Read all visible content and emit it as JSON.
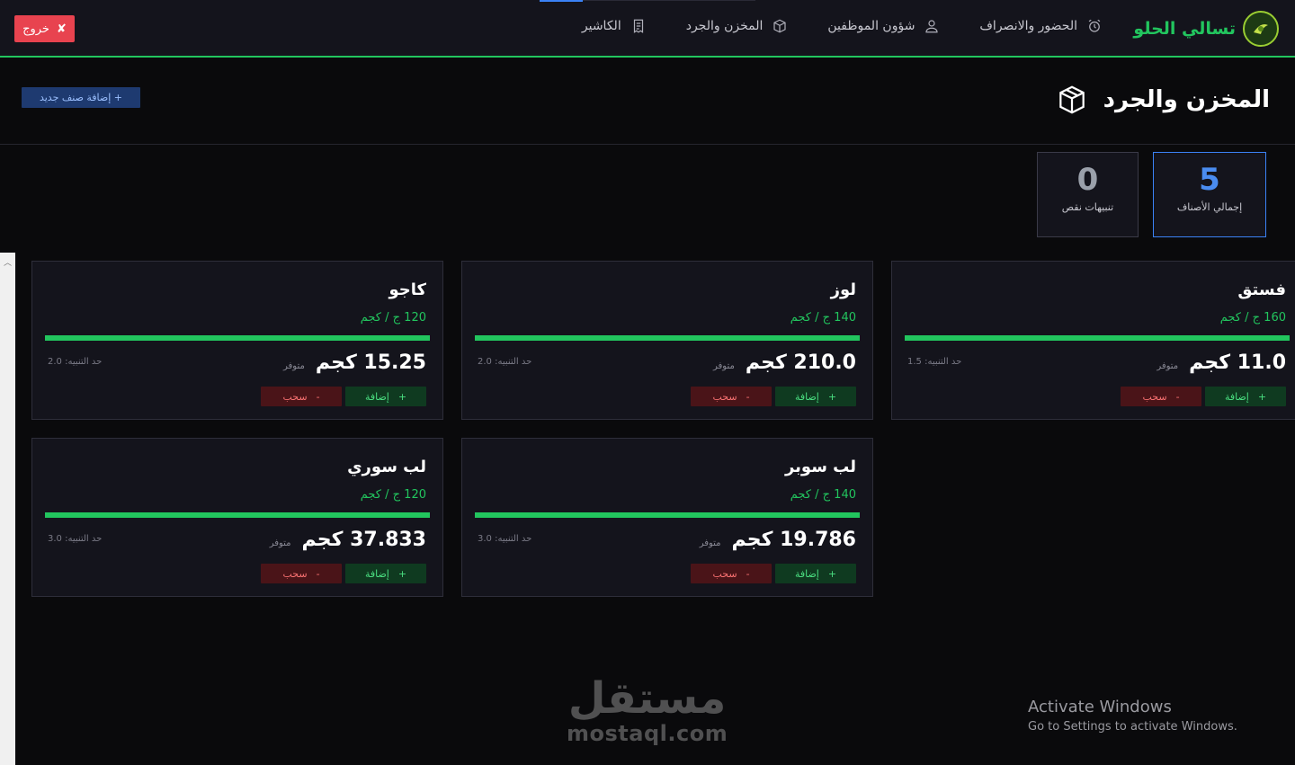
{
  "nav": {
    "brand": "تسالي الحلو",
    "items": [
      {
        "label": "الحضور والانصراف",
        "icon": "alarm-clock-icon"
      },
      {
        "label": "شؤون الموظفين",
        "icon": "user-icon"
      },
      {
        "label": "المخزن والجرد",
        "icon": "box-icon"
      },
      {
        "label": "الكاشير",
        "icon": "receipt-icon"
      }
    ],
    "logout": "خروج",
    "logout_icon": "✘"
  },
  "header": {
    "title": "المخزن والجرد",
    "add_button": "إضافة صنف جديد +"
  },
  "stats": {
    "total": {
      "value": "5",
      "label": "إجمالي الأصناف"
    },
    "alerts": {
      "value": "0",
      "label": "تنبيهات نقص"
    }
  },
  "products": [
    {
      "name": "فستق",
      "price": "160 ج / كجم",
      "qty": "11.0 كجم",
      "available": "متوفر",
      "threshold": "حد التنبيه: 1.5",
      "add": "إضافة",
      "withdraw": "سحب",
      "stock_level": 1.0
    },
    {
      "name": "لوز",
      "price": "140 ج / كجم",
      "qty": "210.0 كجم",
      "available": "متوفر",
      "threshold": "حد التنبيه: 2.0",
      "add": "إضافة",
      "withdraw": "سحب",
      "stock_level": 1.0
    },
    {
      "name": "كاجو",
      "price": "120 ج / كجم",
      "qty": "15.25 كجم",
      "available": "متوفر",
      "threshold": "حد التنبيه: 2.0",
      "add": "إضافة",
      "withdraw": "سحب",
      "stock_level": 1.0
    },
    {
      "name": "لب سوبر",
      "price": "140 ج / كجم",
      "qty": "19.786 كجم",
      "available": "متوفر",
      "threshold": "حد التنبيه: 3.0",
      "add": "إضافة",
      "withdraw": "سحب",
      "stock_level": 1.0
    },
    {
      "name": "لب سوري",
      "price": "120 ج / كجم",
      "qty": "37.833 كجم",
      "available": "متوفر",
      "threshold": "حد التنبيه: 3.0",
      "add": "إضافة",
      "withdraw": "سحب",
      "stock_level": 1.0
    }
  ],
  "watermark": {
    "ar": "مستقل",
    "en": "mostaql.com"
  },
  "os_notice": {
    "title": "Activate Windows",
    "subtitle": "Go to Settings to activate Windows."
  },
  "colors": {
    "accent": "#22c55e",
    "primary": "#3b82f6",
    "danger": "#e8434f",
    "background": "#0a0a0c"
  }
}
